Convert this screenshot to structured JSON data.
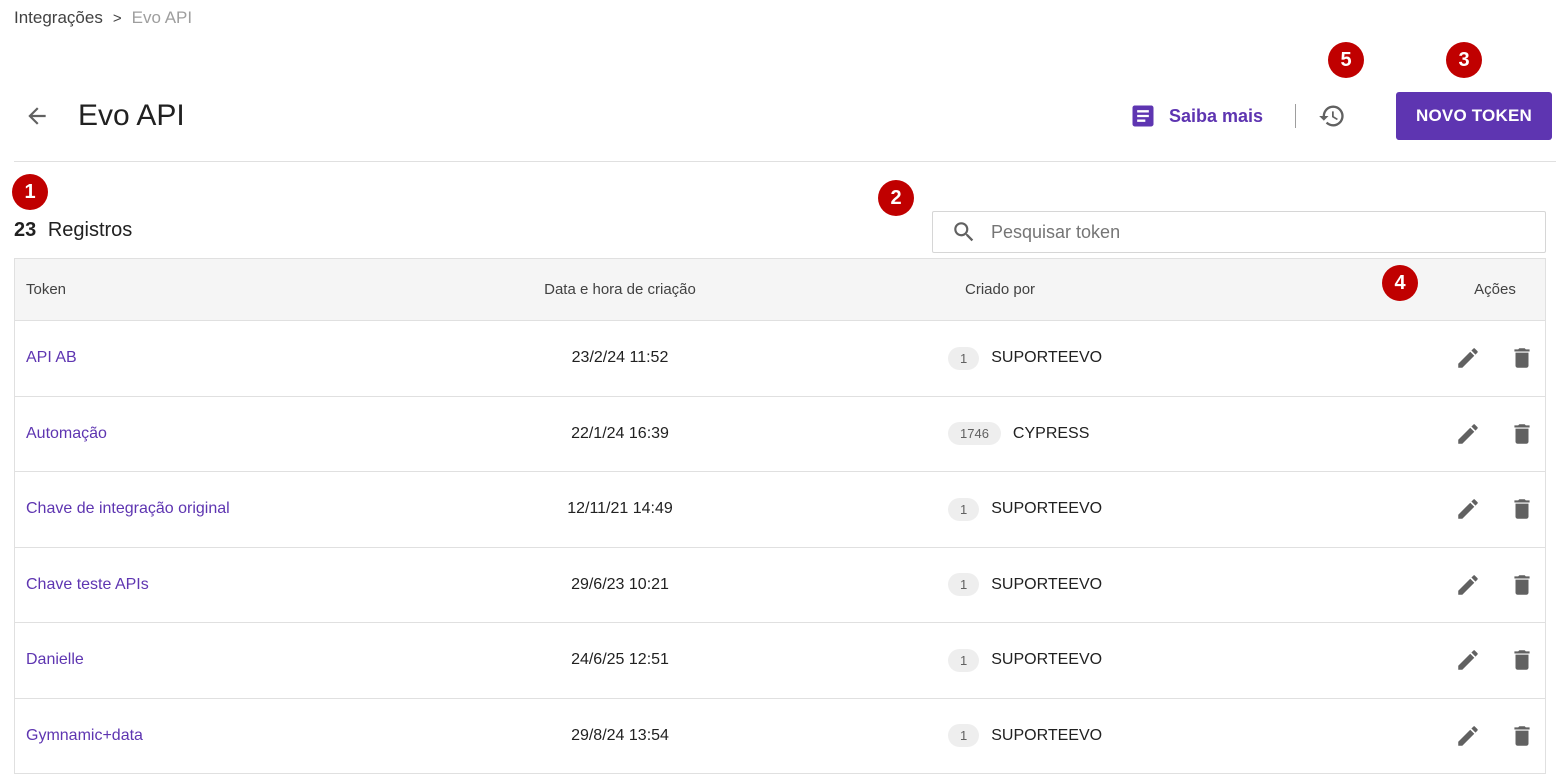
{
  "breadcrumb": {
    "parent": "Integrações",
    "separator": ">",
    "current": "Evo API"
  },
  "header": {
    "title": "Evo API",
    "saiba_mais": "Saiba mais",
    "novo_token": "NOVO TOKEN"
  },
  "badges": {
    "b1": "1",
    "b2": "2",
    "b3": "3",
    "b4": "4",
    "b5": "5"
  },
  "records": {
    "count": "23",
    "label": "Registros"
  },
  "search": {
    "placeholder": "Pesquisar token",
    "value": ""
  },
  "table": {
    "columns": {
      "token": "Token",
      "date": "Data e hora de criação",
      "created_by": "Criado por",
      "actions": "Ações"
    },
    "rows": [
      {
        "token": "API AB",
        "date": "23/2/24 11:52",
        "user_id": "1",
        "user": "SUPORTEEVO"
      },
      {
        "token": "Automação",
        "date": "22/1/24 16:39",
        "user_id": "1746",
        "user": "CYPRESS"
      },
      {
        "token": "Chave de integração original",
        "date": "12/11/21 14:49",
        "user_id": "1",
        "user": "SUPORTEEVO"
      },
      {
        "token": "Chave teste APIs",
        "date": "29/6/23 10:21",
        "user_id": "1",
        "user": "SUPORTEEVO"
      },
      {
        "token": "Danielle",
        "date": "24/6/25 12:51",
        "user_id": "1",
        "user": "SUPORTEEVO"
      },
      {
        "token": "Gymnamic+data",
        "date": "29/8/24 13:54",
        "user_id": "1",
        "user": "SUPORTEEVO"
      }
    ]
  },
  "colors": {
    "accent": "#5e35b1",
    "badge": "#c00000"
  },
  "icons": {
    "back": "arrow-left-icon",
    "doc": "document-icon",
    "history": "history-icon",
    "search": "search-icon",
    "edit": "pencil-icon",
    "delete": "trash-icon"
  }
}
